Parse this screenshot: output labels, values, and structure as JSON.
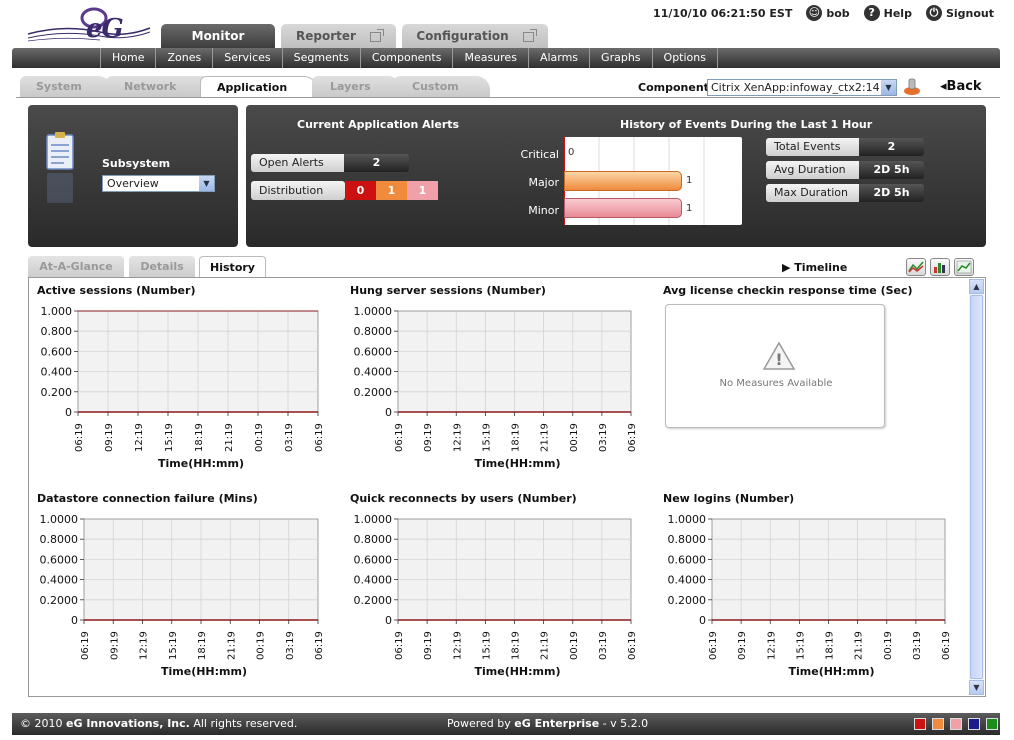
{
  "header": {
    "logo_text": "eG",
    "tabs": [
      {
        "label": "Monitor"
      },
      {
        "label": "Reporter"
      },
      {
        "label": "Configuration"
      }
    ],
    "datetime": "11/10/10 06:21:50 EST",
    "user": "bob",
    "help": "Help",
    "signout": "Signout"
  },
  "nav": {
    "items": [
      "Home",
      "Zones",
      "Services",
      "Segments",
      "Components",
      "Measures",
      "Alarms",
      "Graphs",
      "Options"
    ]
  },
  "subtabs": [
    "System",
    "Network",
    "Application",
    "Layers",
    "Custom"
  ],
  "component": {
    "label": "Component",
    "value": "Citrix XenApp:infoway_ctx2:14",
    "back": "Back"
  },
  "subsystem": {
    "label": "Subsystem",
    "value": "Overview"
  },
  "alerts": {
    "title": "Current Application Alerts",
    "open_label": "Open Alerts",
    "open_value": "2",
    "dist_label": "Distribution",
    "dist_values": [
      "0",
      "1",
      "1"
    ]
  },
  "history": {
    "title": "History of Events During the Last 1 Hour",
    "rows": [
      {
        "label": "Critical",
        "value": "0"
      },
      {
        "label": "Major",
        "value": "1"
      },
      {
        "label": "Minor",
        "value": "1"
      }
    ],
    "stats": [
      {
        "label": "Total Events",
        "value": "2"
      },
      {
        "label": "Avg Duration",
        "value": "2D 5h"
      },
      {
        "label": "Max Duration",
        "value": "2D 5h"
      }
    ]
  },
  "inner_tabs": [
    "At-A-Glance",
    "Details",
    "History"
  ],
  "timeline": "Timeline",
  "graphs": [
    {
      "title": "Active sessions (Number)",
      "yticks": [
        "1.000",
        "0.800",
        "0.600",
        "0.400",
        "0.200",
        "0"
      ]
    },
    {
      "title": "Hung server sessions (Number)",
      "yticks": [
        "1.0000",
        "0.8000",
        "0.6000",
        "0.4000",
        "0.2000",
        "0"
      ]
    },
    {
      "title": "Avg license checkin response time (Sec)",
      "no_data": "No Measures Available"
    },
    {
      "title": "Datastore connection failure (Mins)",
      "yticks": [
        "1.0000",
        "0.8000",
        "0.6000",
        "0.4000",
        "0.2000",
        "0"
      ]
    },
    {
      "title": "Quick reconnects by users (Number)",
      "yticks": [
        "1.0000",
        "0.8000",
        "0.6000",
        "0.4000",
        "0.2000",
        "0"
      ]
    },
    {
      "title": "New logins (Number)",
      "yticks": [
        "1.0000",
        "0.8000",
        "0.6000",
        "0.4000",
        "0.2000",
        "0"
      ]
    }
  ],
  "xticks": [
    "06:19",
    "09:19",
    "12:19",
    "15:19",
    "18:19",
    "21:19",
    "00:19",
    "03:19",
    "06:19"
  ],
  "xlabel": "Time(HH:mm)",
  "footer": {
    "copyright_prefix": "© 2010 ",
    "company": "eG Innovations, Inc.",
    "rights": " All rights reserved.",
    "powered_prefix": "Powered by ",
    "product": "eG Enterprise",
    "version": "  - v 5.2.0"
  },
  "colors": {
    "critical": "#cc1111",
    "major": "#f08a3c",
    "minor": "#f0a0a8",
    "swatches": [
      "#cc1111",
      "#f08a3c",
      "#f0a0a8",
      "#1a1a8c",
      "#1a8c1a"
    ]
  }
}
